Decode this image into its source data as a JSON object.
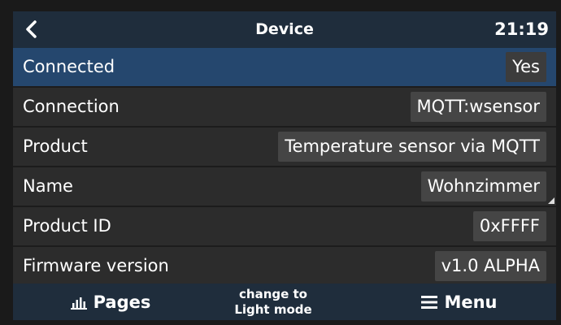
{
  "header": {
    "title": "Device",
    "time": "21:19"
  },
  "rows": [
    {
      "label": "Connected",
      "value": "Yes"
    },
    {
      "label": "Connection",
      "value": "MQTT:wsensor"
    },
    {
      "label": "Product",
      "value": "Temperature sensor via MQTT"
    },
    {
      "label": "Name",
      "value": "Wohnzimmer"
    },
    {
      "label": "Product ID",
      "value": "0xFFFF"
    },
    {
      "label": "Firmware version",
      "value": "v1.0 ALPHA"
    }
  ],
  "footer": {
    "pages_label": "Pages",
    "mode_line1": "change to",
    "mode_line2": "Light mode",
    "menu_label": "Menu"
  },
  "icons": {
    "back": "chevron-left-icon",
    "pages": "bar-chart-icon",
    "menu": "hamburger-menu-icon"
  },
  "colors": {
    "header": "#1f2d3c",
    "selected_row": "#25476e",
    "background": "#2b2b2b"
  }
}
